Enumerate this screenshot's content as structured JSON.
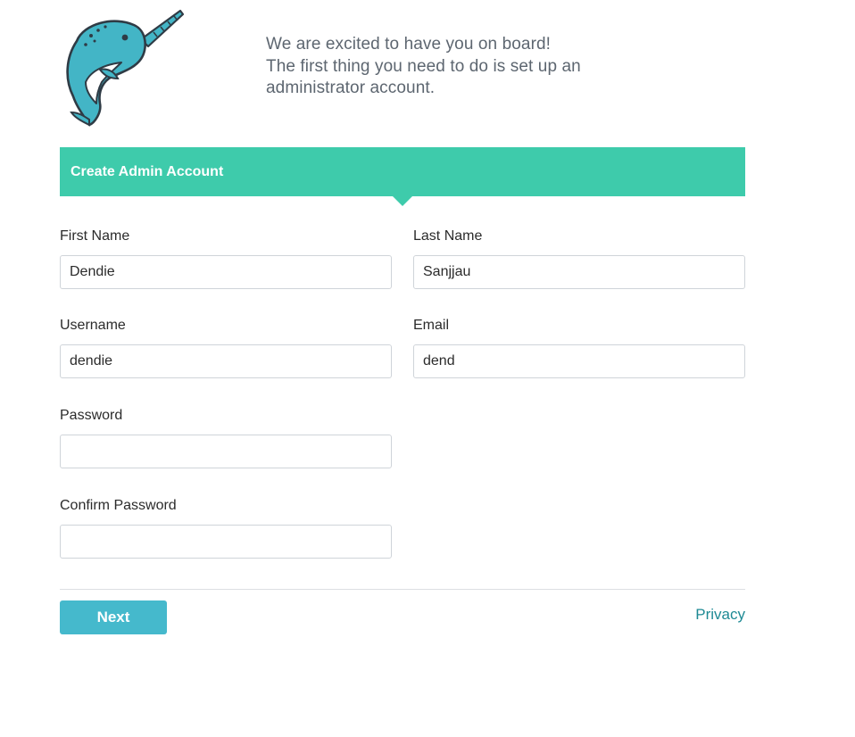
{
  "logo": {
    "icon": "narwhal-logo-icon",
    "colors": {
      "body": "#43b5c6",
      "belly": "#ffffff",
      "outline": "#2f3b45"
    }
  },
  "welcome": {
    "line1": "We are excited to have you on board!",
    "line2": "The first thing you need to do is set up an",
    "line3": "administrator account."
  },
  "banner": {
    "title": "Create Admin Account",
    "color": "#3ecbab"
  },
  "form": {
    "first_name": {
      "label": "First Name",
      "value": "Dendie"
    },
    "last_name": {
      "label": "Last Name",
      "value": "Sanjjau"
    },
    "username": {
      "label": "Username",
      "value": "dendie"
    },
    "email": {
      "label": "Email",
      "value": "dend"
    },
    "password": {
      "label": "Password",
      "value": ""
    },
    "confirm_password": {
      "label": "Confirm Password",
      "value": ""
    }
  },
  "footer": {
    "next_label": "Next",
    "next_color": "#45b9cc",
    "privacy_label": "Privacy",
    "privacy_color": "#1e8a94"
  }
}
